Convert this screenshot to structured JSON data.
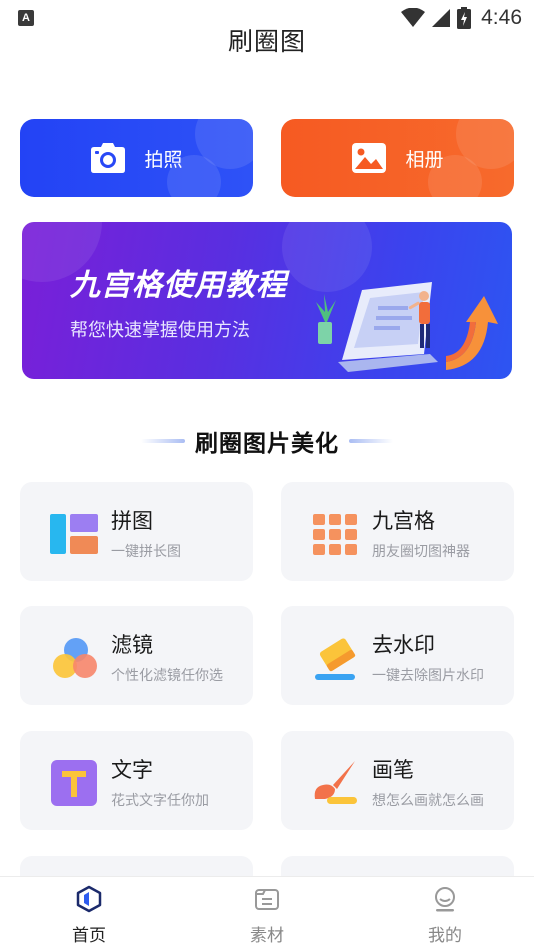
{
  "status_bar": {
    "indicator": "A",
    "time": "4:46"
  },
  "app_title": "刷圈图",
  "actions": [
    {
      "label": "拍照",
      "icon": "camera-icon",
      "color": "#2343f5"
    },
    {
      "label": "相册",
      "icon": "image-icon",
      "color": "#f65a22"
    }
  ],
  "banner": {
    "title": "九宫格使用教程",
    "subtitle": "帮您快速掌握使用方法"
  },
  "section": {
    "title": "刷圈图片美化"
  },
  "features": [
    {
      "title": "拼图",
      "subtitle": "一键拼长图",
      "icon": "collage-icon"
    },
    {
      "title": "九宫格",
      "subtitle": "朋友圈切图神器",
      "icon": "grid-icon"
    },
    {
      "title": "滤镜",
      "subtitle": "个性化滤镜任你选",
      "icon": "filter-icon"
    },
    {
      "title": "去水印",
      "subtitle": "一键去除图片水印",
      "icon": "eraser-icon"
    },
    {
      "title": "文字",
      "subtitle": "花式文字任你加",
      "icon": "text-icon"
    },
    {
      "title": "画笔",
      "subtitle": "想怎么画就怎么画",
      "icon": "brush-icon"
    }
  ],
  "nav": [
    {
      "label": "首页",
      "icon": "home-icon",
      "active": true
    },
    {
      "label": "素材",
      "icon": "material-icon",
      "active": false
    },
    {
      "label": "我的",
      "icon": "profile-icon",
      "active": false
    }
  ]
}
